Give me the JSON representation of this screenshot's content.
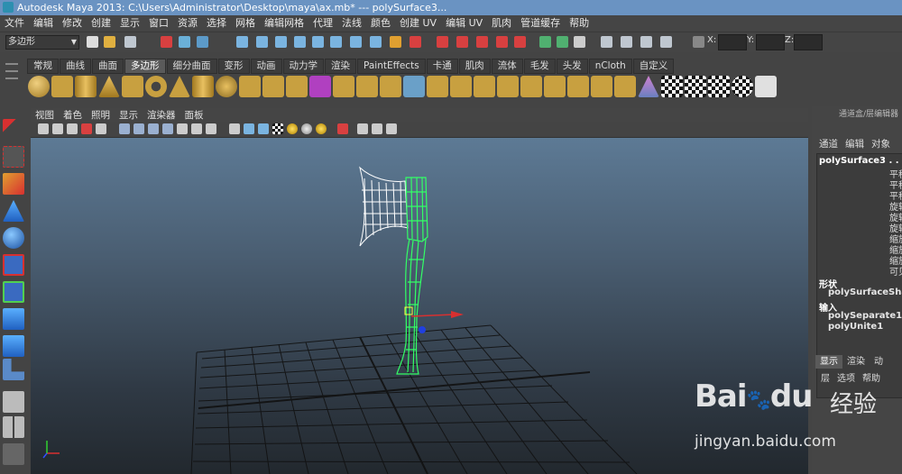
{
  "window": {
    "title": "Autodesk Maya 2013: C:\\Users\\Administrator\\Desktop\\maya\\ax.mb*   ---   polySurface3..."
  },
  "menubar": {
    "items": [
      "文件",
      "编辑",
      "修改",
      "创建",
      "显示",
      "窗口",
      "资源",
      "选择",
      "网格",
      "编辑网格",
      "代理",
      "法线",
      "颜色",
      "创建 UV",
      "编辑 UV",
      "肌肉",
      "管道缓存",
      "帮助"
    ]
  },
  "statusline": {
    "mode": "多边形",
    "x_label": "X:",
    "y_label": "Y:",
    "z_label": "Z:"
  },
  "shelf": {
    "tabs": [
      "常规",
      "曲线",
      "曲面",
      "多边形",
      "细分曲面",
      "变形",
      "动画",
      "动力学",
      "渲染",
      "PaintEffects",
      "卡通",
      "肌肉",
      "流体",
      "毛发",
      "头发",
      "nCloth",
      "自定义"
    ],
    "active_tab": "多边形"
  },
  "viewport": {
    "menu": [
      "视图",
      "着色",
      "照明",
      "显示",
      "渲染器",
      "面板"
    ]
  },
  "channel_box": {
    "title": "通道盒/层编辑器",
    "menu": [
      "通道",
      "编辑",
      "对象"
    ],
    "object_name": "polySurface3 . . .",
    "attributes": [
      "平移",
      "平移",
      "平移",
      "旋转",
      "旋转",
      "旋转",
      "缩放",
      "缩放",
      "缩放",
      "可见"
    ],
    "shape_header": "形状",
    "shape_node": "polySurfaceShape",
    "input_header": "输入",
    "input_nodes": [
      "polySeparate1",
      "polyUnite1"
    ]
  },
  "layer_editor": {
    "tabs": [
      "显示",
      "渲染",
      "动"
    ],
    "active_tab": "显示",
    "menu": [
      "层",
      "选项",
      "帮助"
    ]
  },
  "watermark": {
    "logo": "Bai",
    "logo2": "du",
    "name": "经验",
    "url": "jingyan.baidu.com"
  },
  "colors": {
    "accent": "#6a93c2",
    "wireframe_selected": "#33ff66",
    "grid": "#111111"
  }
}
